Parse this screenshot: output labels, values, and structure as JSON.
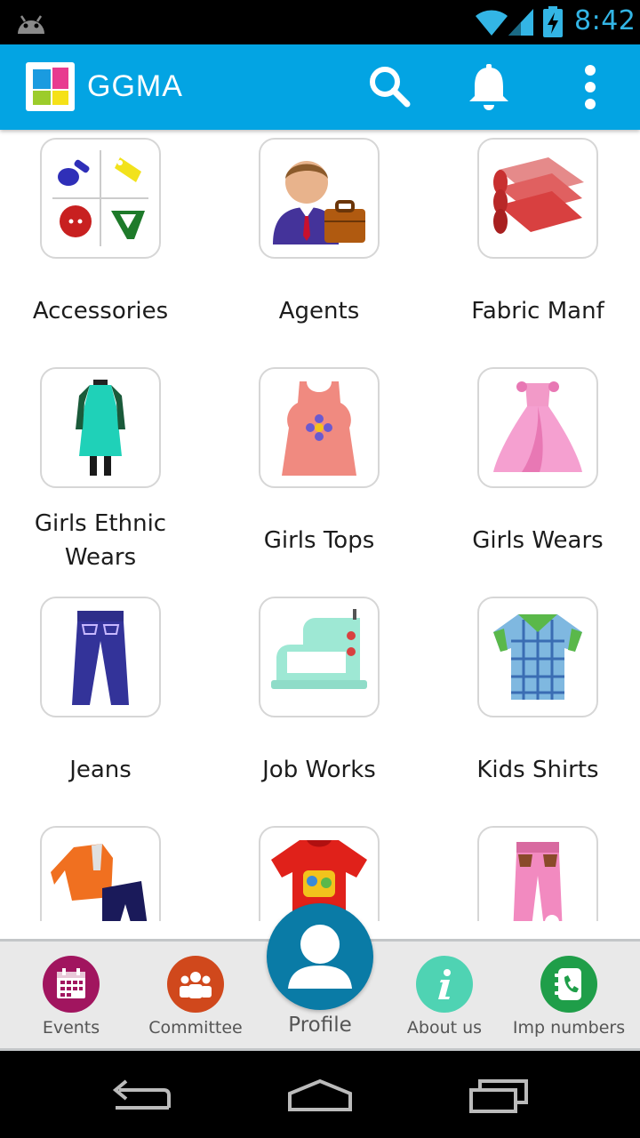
{
  "status_bar": {
    "time": "8:42",
    "icons": [
      "android-icon",
      "wifi-icon",
      "signal-icon",
      "battery-charging-icon"
    ],
    "accent_color": "#33b5e5"
  },
  "app_bar": {
    "title": "GGMA",
    "background": "#03a4e3",
    "actions": [
      "search-icon",
      "bell-icon",
      "more-vert-icon"
    ]
  },
  "categories": [
    {
      "label": "Accessories",
      "icon": "accessories-icon"
    },
    {
      "label": "Agents",
      "icon": "agent-businessman-icon"
    },
    {
      "label": "Fabric Manf",
      "icon": "fabric-rolls-icon"
    },
    {
      "label": "Girls Ethnic Wears",
      "icon": "ethnic-kurta-icon"
    },
    {
      "label": "Girls Tops",
      "icon": "tank-top-icon"
    },
    {
      "label": "Girls Wears",
      "icon": "pink-gown-icon"
    },
    {
      "label": "Jeans",
      "icon": "jeans-icon"
    },
    {
      "label": "Job Works",
      "icon": "sewing-machine-icon"
    },
    {
      "label": "Kids Shirts",
      "icon": "checked-shirt-icon"
    },
    {
      "label": "",
      "icon": "kids-outfit-icon"
    },
    {
      "label": "",
      "icon": "red-tshirt-icon"
    },
    {
      "label": "",
      "icon": "pink-pants-icon"
    }
  ],
  "bottom_nav": {
    "items": [
      {
        "label": "Events",
        "icon": "calendar-icon",
        "color": "#a1155f"
      },
      {
        "label": "Committee",
        "icon": "group-icon",
        "color": "#d0481c"
      },
      {
        "label": "Profile",
        "icon": "person-icon",
        "color": "#0a7ba6"
      },
      {
        "label": "About us",
        "icon": "info-icon",
        "color": "#4fd3b3"
      },
      {
        "label": "Imp numbers",
        "icon": "phone-book-icon",
        "color": "#1f9e49"
      }
    ]
  },
  "system_nav": [
    "back-icon",
    "home-icon",
    "recents-icon"
  ]
}
